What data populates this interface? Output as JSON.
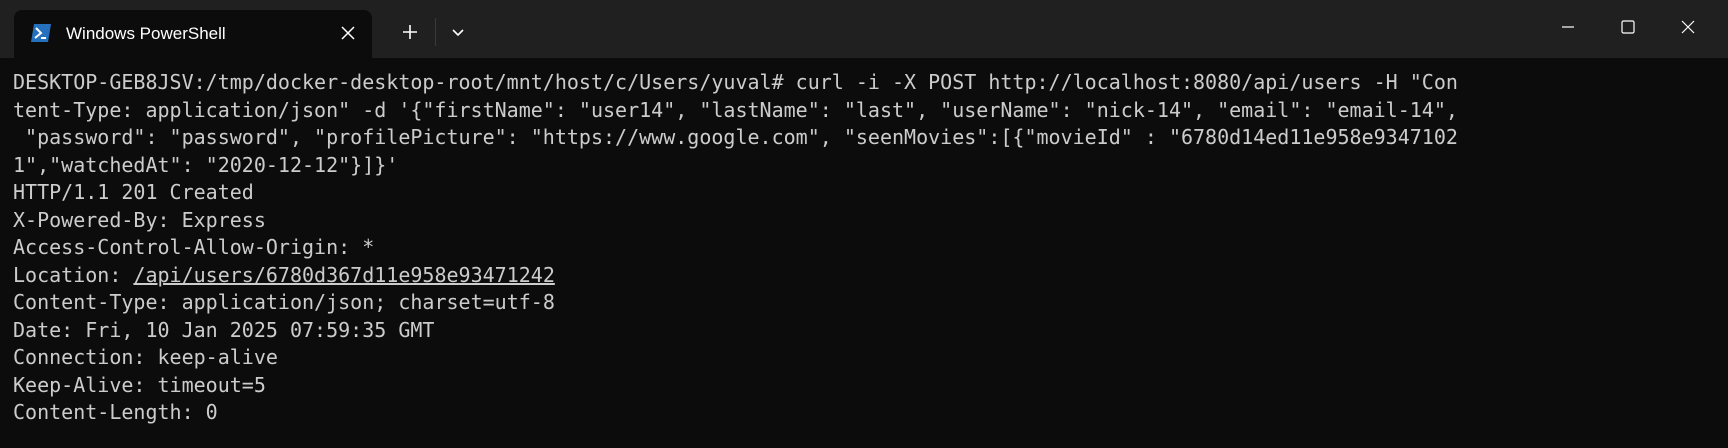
{
  "window": {
    "tab_title": "Windows PowerShell",
    "tab_icon": "powershell-icon",
    "new_tab_icon": "plus-icon",
    "dropdown_icon": "chevron-down-icon",
    "minimize_icon": "minimize-icon",
    "maximize_icon": "maximize-icon",
    "close_icon": "close-icon"
  },
  "colors": {
    "titlebar_bg": "#202020",
    "terminal_bg": "#0c0c0c",
    "terminal_fg": "#cccccc",
    "powershell_icon_bg": "#2671be"
  },
  "terminal": {
    "command_lines": [
      "DESKTOP-GEB8JSV:/tmp/docker-desktop-root/mnt/host/c/Users/yuval# curl -i -X POST http://localhost:8080/api/users -H \"Con",
      "tent-Type: application/json\" -d '{\"firstName\": \"user14\", \"lastName\": \"last\", \"userName\": \"nick-14\", \"email\": \"email-14\",",
      " \"password\": \"password\", \"profilePicture\": \"https://www.google.com\", \"seenMovies\":[{\"movieId\" : \"6780d14ed11e958e9347102",
      "1\",\"watchedAt\": \"2020-12-12\"}]}'"
    ],
    "status_line": "HTTP/1.1 201 Created",
    "headers": [
      {
        "key": "X-Powered-By",
        "value": "Express"
      },
      {
        "key": "Access-Control-Allow-Origin",
        "value": "*"
      },
      {
        "key": "Location",
        "value": "/api/users/6780d367d11e958e93471242"
      },
      {
        "key": "Content-Type",
        "value": "application/json; charset=utf-8"
      },
      {
        "key": "Date",
        "value": "Fri, 10 Jan 2025 07:59:35 GMT"
      },
      {
        "key": "Connection",
        "value": "keep-alive"
      },
      {
        "key": "Keep-Alive",
        "value": "timeout=5"
      },
      {
        "key": "Content-Length",
        "value": "0"
      }
    ]
  }
}
